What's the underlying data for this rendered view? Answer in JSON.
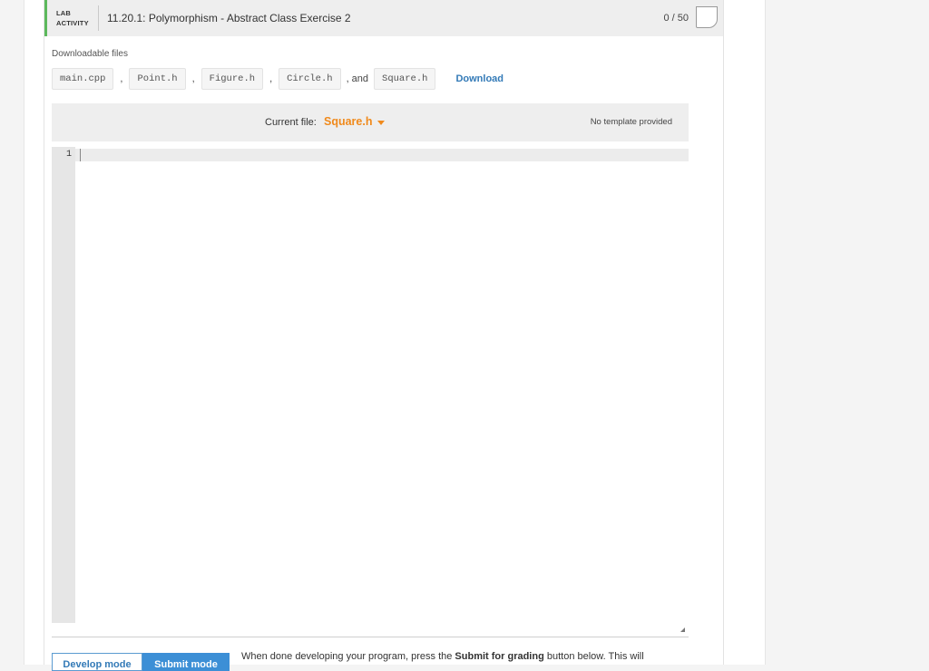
{
  "header": {
    "tag_line1": "LAB",
    "tag_line2": "ACTIVITY",
    "title": "11.20.1: Polymorphism - Abstract Class Exercise 2",
    "score": "0 / 50"
  },
  "downloads": {
    "label": "Downloadable files",
    "files": [
      "main.cpp",
      "Point.h",
      "Figure.h",
      "Circle.h",
      "Square.h"
    ],
    "separator": ",",
    "and_text": ", and",
    "download_label": "Download"
  },
  "editor": {
    "current_file_label": "Current file:",
    "current_file": "Square.h",
    "no_template": "No template provided",
    "line_numbers": [
      "1"
    ]
  },
  "modes": {
    "develop_label": "Develop mode",
    "submit_label": "Submit mode",
    "note_prefix": "When done developing your program, press the ",
    "note_bold": "Submit for grading",
    "note_suffix": " button below. This will"
  },
  "colors": {
    "accent_green": "#5cb85c",
    "link_blue": "#337ab7",
    "current_file_orange": "#f08a1c",
    "submit_tab_blue": "#3c8fd6"
  }
}
